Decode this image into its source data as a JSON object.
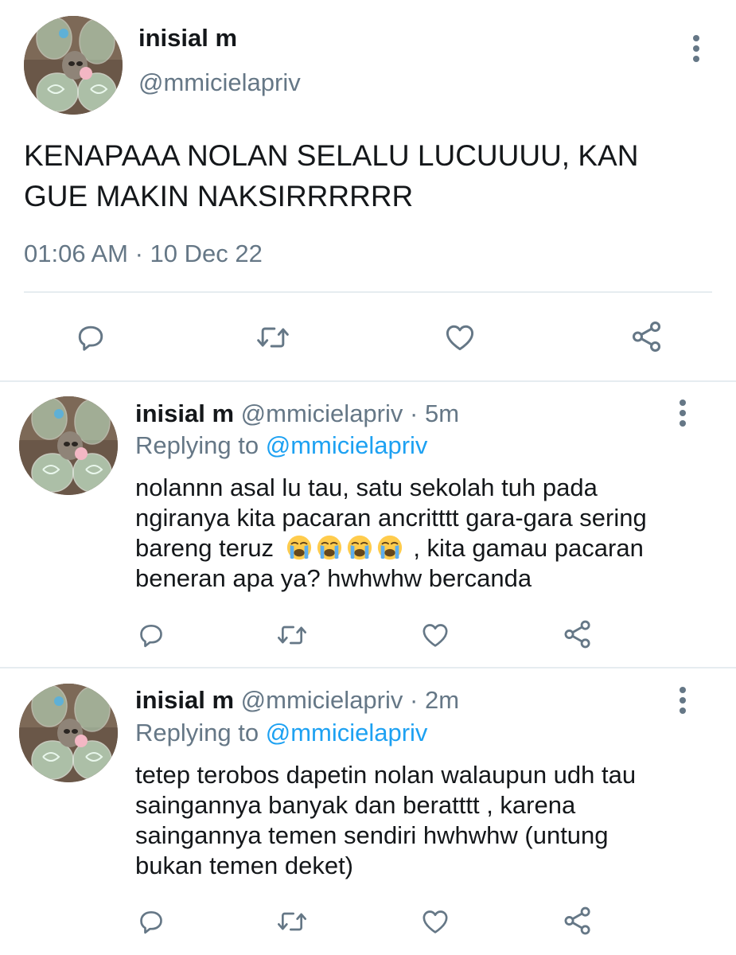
{
  "main_tweet": {
    "display_name": "inisial m",
    "handle": "@mmicielapriv",
    "text_line1": "KENAPAAA NOLAN SELALU LUCUUUU, KAN",
    "text_line2": "GUE MAKIN NAKSIRRRRRR",
    "timestamp": "01:06 AM · 10 Dec 22",
    "actions": [
      "reply-icon",
      "retweet-icon",
      "like-icon",
      "share-icon"
    ]
  },
  "replies": [
    {
      "display_name": "inisial m",
      "handle": "@mmicielapriv",
      "time": "· 5m",
      "replying_prefix": "Replying to",
      "replying_handle": "@mmicielapriv",
      "lines": [
        "nolannn asal lu tau, satu sekolah tuh pada",
        "ngiranya kita pacaran ancritttt gara-gara sering",
        "bareng teruz",
        ", kita gamau pacaran",
        "beneran apa ya? hwhwhw bercanda"
      ],
      "emojis": [
        "loudly-crying-face",
        "loudly-crying-face",
        "loudly-crying-face",
        "loudly-crying-face"
      ]
    },
    {
      "display_name": "inisial m",
      "handle": "@mmicielapriv",
      "time": "· 2m",
      "replying_prefix": "Replying to",
      "replying_handle": "@mmicielapriv",
      "lines": [
        "tetep terobos dapetin nolan walaupun udh tau",
        "saingannya banyak dan beratttt , karena",
        "saingannya temen sendiri hwhwhw (untung",
        "bukan temen deket)"
      ]
    }
  ],
  "colors": {
    "text": "#14171a",
    "muted": "#657786",
    "accent": "#1da1f2",
    "divider": "#e6ecf0"
  }
}
